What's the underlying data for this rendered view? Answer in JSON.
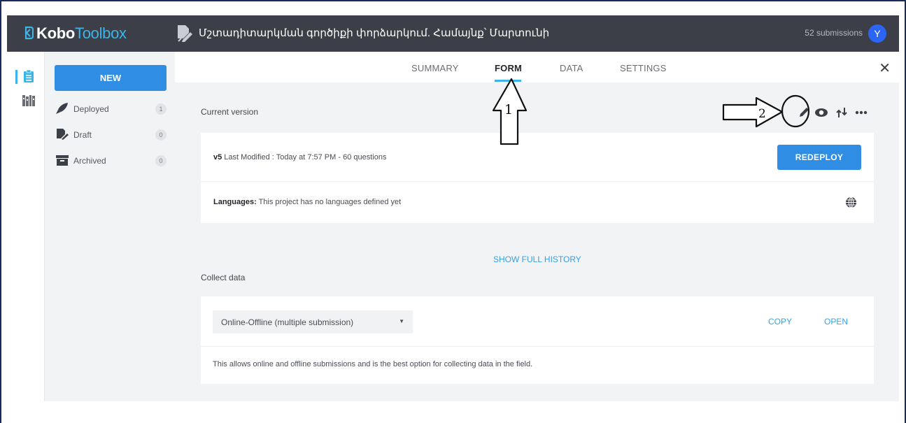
{
  "app": {
    "logo_bold": "Kobo",
    "logo_thin": "Toolbox",
    "project_title": "Մշտադիտարկման գործիքի փորձարկում. Համայնք՝ Մարտունի",
    "submissions": "52 submissions",
    "avatar_letter": "Y"
  },
  "sidebar": {
    "new_label": "NEW",
    "items": [
      {
        "label": "Deployed",
        "count": "1",
        "icon": "rocket-icon"
      },
      {
        "label": "Draft",
        "count": "0",
        "icon": "draft-icon"
      },
      {
        "label": "Archived",
        "count": "0",
        "icon": "archive-icon"
      }
    ]
  },
  "tabs": [
    {
      "label": "SUMMARY",
      "active": false
    },
    {
      "label": "FORM",
      "active": true
    },
    {
      "label": "DATA",
      "active": false
    },
    {
      "label": "SETTINGS",
      "active": false
    }
  ],
  "form": {
    "current_version_label": "Current version",
    "version": "v5",
    "version_detail": " Last Modified : Today at 7:57 PM - 60 questions",
    "redeploy_label": "REDEPLOY",
    "languages_label": "Languages:",
    "languages_text": " This project has no languages defined yet",
    "show_history": "SHOW FULL HISTORY",
    "collect_label": "Collect data",
    "collect_option": "Online-Offline (multiple submission)",
    "copy_label": "COPY",
    "open_label": "OPEN",
    "collect_desc": "This allows online and offline submissions and is the best option for collecting data in the field."
  },
  "annotations": {
    "arrow1_number": "1",
    "arrow2_number": "2"
  },
  "colors": {
    "topbar": "#3c3f48",
    "accent": "#2f8de4",
    "link": "#3aa0e0",
    "avatar": "#2c64f6"
  }
}
